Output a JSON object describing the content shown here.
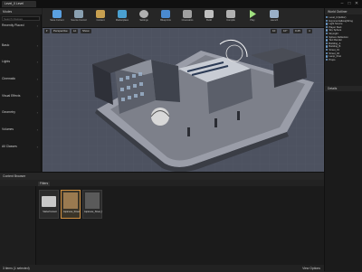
{
  "window": {
    "tab_title": "Level_0 Level",
    "controls": [
      "–",
      "□",
      "✕"
    ]
  },
  "left_panel": {
    "tab": "Modes",
    "search_placeholder": "Search Classes",
    "items": [
      "Recently Placed",
      "Basic",
      "Lights",
      "Cinematic",
      "Visual Effects",
      "Geometry",
      "Volumes",
      "All Classes"
    ]
  },
  "toolbar": {
    "buttons": [
      {
        "label": "Save Current",
        "icon": "save-icon",
        "color": "#5aa0e0"
      },
      {
        "label": "Source Control",
        "icon": "source-control-icon",
        "color": "#8aa0b0"
      },
      {
        "label": "Content",
        "icon": "content-icon",
        "color": "#c8a050"
      },
      {
        "label": "Marketplace",
        "icon": "marketplace-icon",
        "color": "#4aa0d0"
      },
      {
        "label": "Settings",
        "icon": "settings-icon",
        "color": "#b0b0b0"
      },
      {
        "label": "Blueprints",
        "icon": "blueprints-icon",
        "color": "#4a8ad0"
      },
      {
        "label": "Cinematics",
        "icon": "cinematics-icon",
        "color": "#a0a0a0"
      },
      {
        "label": "Build",
        "icon": "build-icon",
        "color": "#c0c0c0"
      },
      {
        "label": "Compile",
        "icon": "compile-icon",
        "color": "#b0b0b0"
      },
      {
        "label": "Play",
        "icon": "play-icon",
        "color": "#a0e080"
      },
      {
        "label": "Launch",
        "icon": "launch-icon",
        "color": "#9ab0c8"
      }
    ]
  },
  "viewport": {
    "chips": [
      "Perspective",
      "Lit",
      "Show"
    ],
    "right_chips": [
      "10",
      "10°",
      "0.25",
      "4"
    ]
  },
  "outliner": {
    "title": "World Outliner",
    "rows": [
      "Level_0 (Editor)",
      "ExponentialHeightFog",
      "Light Source",
      "Player Start",
      "Sky Sphere",
      "SkyLight",
      "Sphere Reflection",
      "Text Render",
      "Building_A",
      "Building_B",
      "Street_01",
      "Street_02",
      "Lamp_Post",
      "Props"
    ],
    "details_title": "Details"
  },
  "content": {
    "title": "Content Browser",
    "filter_label": "Filters",
    "assets": [
      {
        "name": "StarterContent",
        "kind": "folder"
      },
      {
        "name": "Japanese_Street",
        "kind": "selected"
      },
      {
        "name": "Japanese_Street_BuiltData",
        "kind": "data"
      }
    ],
    "status": "3 items (1 selected)",
    "view_options": "View Options"
  }
}
